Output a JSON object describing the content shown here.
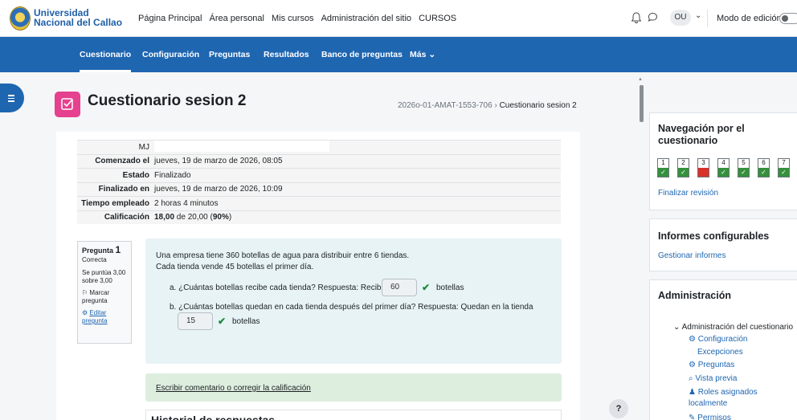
{
  "topbar": {
    "brand_line1": "Universidad",
    "brand_line2": "Nacional del Callao",
    "nav": [
      "Página Principal",
      "Área personal",
      "Mis cursos",
      "Administración del sitio",
      "CURSOS"
    ],
    "user_initials": "OU",
    "edit_mode_label": "Modo de edición"
  },
  "secondary_nav": {
    "items": [
      "Cuestionario",
      "Configuración",
      "Preguntas",
      "Resultados",
      "Banco de preguntas",
      "Más"
    ],
    "active": "Cuestionario"
  },
  "page": {
    "title": "Cuestionario sesion 2",
    "breadcrumb": [
      "2026o-01-AMAT-1553-706",
      "Cuestionario sesion 2"
    ]
  },
  "summary": {
    "user_initials": "MJ",
    "rows": [
      {
        "label": "Comenzado el",
        "value": "jueves, 19 de marzo de 2026, 08:05"
      },
      {
        "label": "Estado",
        "value": "Finalizado"
      },
      {
        "label": "Finalizado en",
        "value": "jueves, 19 de marzo de 2026, 10:09"
      },
      {
        "label": "Tiempo empleado",
        "value": "2 horas 4 minutos"
      }
    ],
    "grade_label": "Calificación",
    "grade_bold": "18,00",
    "grade_rest": " de 20,00 (",
    "grade_pct": "90%",
    "grade_end": ")"
  },
  "question": {
    "label": "Pregunta",
    "number": "1",
    "status": "Correcta",
    "score": "Se puntúa 3,00 sobre 3,00",
    "flag": "Marcar pregunta",
    "edit": "Editar pregunta",
    "text1": "Una empresa tiene 360 botellas de agua para distribuir entre 6 tiendas.",
    "text2": "Cada tienda vende 45 botellas el primer día.",
    "a_prefix": "a. ¿Cuántas botellas recibe cada tienda? Respuesta: Recibe",
    "a_value": "60",
    "a_suffix": "botellas",
    "b_prefix": "b. ¿Cuántas botellas quedan en cada tienda después del primer día? Respuesta: Quedan en la tienda",
    "b_value": "15",
    "b_suffix": "botellas",
    "comment_link": "Escribir comentario o corregir la calificación",
    "history_title": "Historial de respuestas"
  },
  "sidebar": {
    "quiz_nav_title": "Navegación por el cuestionario",
    "nav_buttons": [
      {
        "n": "1",
        "status": "correct"
      },
      {
        "n": "2",
        "status": "correct"
      },
      {
        "n": "3",
        "status": "incorrect"
      },
      {
        "n": "4",
        "status": "correct"
      },
      {
        "n": "5",
        "status": "correct"
      },
      {
        "n": "6",
        "status": "correct"
      },
      {
        "n": "7",
        "status": "correct"
      }
    ],
    "finish_review": "Finalizar revisión",
    "reports_title": "Informes configurables",
    "manage_reports": "Gestionar informes",
    "admin_title": "Administración",
    "admin_root": "Administración del cuestionario",
    "admin_items": [
      "Configuración",
      "Excepciones",
      "Preguntas",
      "Vista previa",
      "Roles asignados localmente",
      "Permisos"
    ]
  },
  "colors": {
    "primary": "#1f66b1",
    "quiz_icon": "#e5418e",
    "correct": "#35903d",
    "incorrect": "#d9312a"
  },
  "help_label": "?"
}
